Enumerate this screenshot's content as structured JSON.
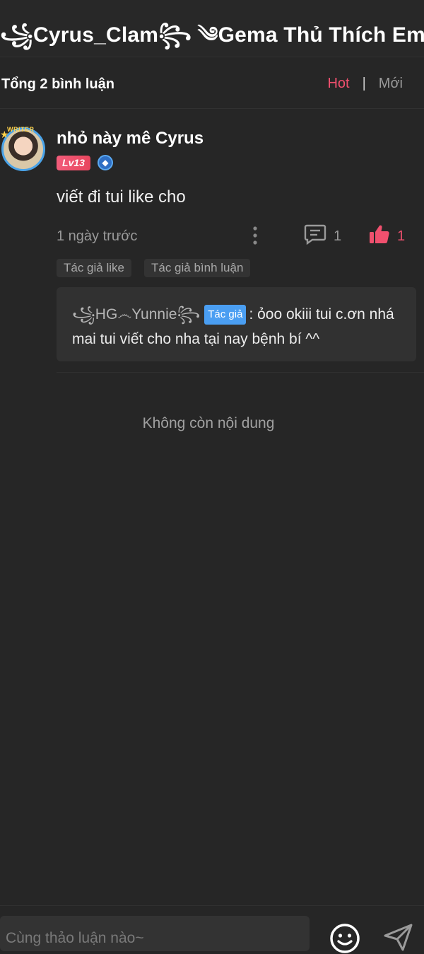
{
  "header": {
    "title": "꧁Cyrus_Clam꧂ ༄Gema Thủ Thích Em."
  },
  "comments_bar": {
    "total_label": "Tổng 2 bình luận",
    "sort_hot": "Hot",
    "sort_separator": "|",
    "sort_new": "Mới"
  },
  "comment": {
    "avatar_badge": "WRITER",
    "author": "nhỏ này mê Cyrus",
    "level": "Lv13",
    "text": "viết đi tui like cho",
    "time": "1 ngày trước",
    "reply_count": "1",
    "like_count": "1",
    "tags": [
      "Tác giả like",
      "Tác giả bình luận"
    ],
    "reply": {
      "author": "꧁HG෴Yunnie꧂",
      "author_tag": "Tác giả",
      "text_line1": ": ỏoo okiii tui c.ơn nhá",
      "text_line2": "mai tui viết cho nha tại nay bệnh bí ^^"
    }
  },
  "end_message": "Không còn nội dung",
  "input": {
    "placeholder": "Cùng thảo luận nào~"
  },
  "colors": {
    "accent": "#f0506e",
    "author_tag": "#4a9ef2",
    "background": "#262626"
  }
}
